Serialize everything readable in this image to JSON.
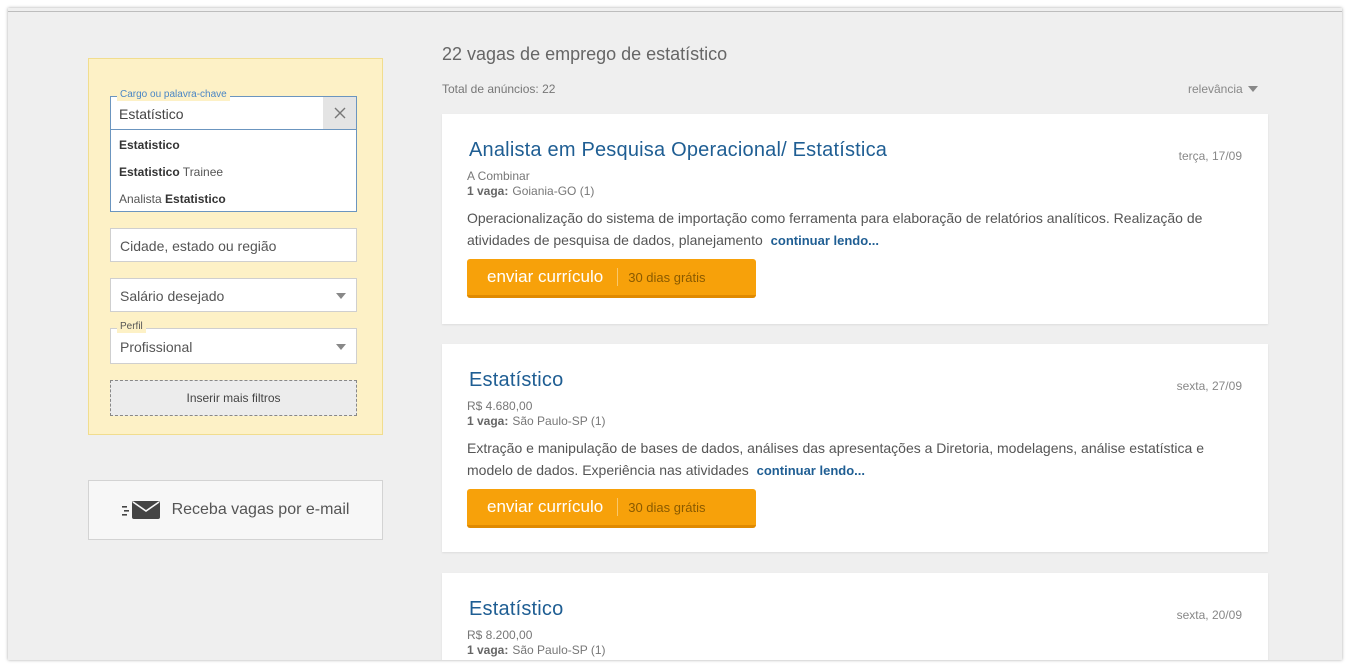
{
  "sidebar": {
    "keyword": {
      "legend": "Cargo ou palavra-chave",
      "value": "Estatístico",
      "suggestions": [
        {
          "bold_prefix": "",
          "bold": "Estatistico",
          "rest": ""
        },
        {
          "bold_prefix": "",
          "bold": "Estatistico",
          "rest": " Trainee"
        },
        {
          "bold_prefix": "Analista ",
          "bold": "Estatistico",
          "rest": ""
        }
      ]
    },
    "city_placeholder": "Cidade, estado ou região",
    "salary_placeholder": "Salário desejado",
    "perfil_legend": "Perfil",
    "perfil_value": "Profissional",
    "more_filters": "Inserir mais filtros",
    "email_alert": "Receba vagas por e-mail"
  },
  "results": {
    "title": "22 vagas de emprego de estatístico",
    "total": "Total de anúncios: 22",
    "sort_label": "relevância"
  },
  "jobs": [
    {
      "title": "Analista em Pesquisa Operacional/ Estatística",
      "date": "terça, 17/09",
      "salary": "A Combinar",
      "vacancies": "1 vaga:",
      "location": "Goiania-GO (1)",
      "description": "Operacionalização do sistema de importação como ferramenta para elaboração de relatórios analíticos. Realização de atividades de pesquisa de dados, planejamento",
      "read_more": "continuar lendo...",
      "apply": "enviar currículo",
      "apply_sub": "30 dias grátis"
    },
    {
      "title": "Estatístico",
      "date": "sexta, 27/09",
      "salary": "R$ 4.680,00",
      "vacancies": "1 vaga:",
      "location": "São Paulo-SP (1)",
      "description": "Extração e manipulação de bases de dados, análises das apresentações a Diretoria, modelagens, análise estatística e modelo de dados. Experiência nas atividades",
      "read_more": "continuar lendo...",
      "apply": "enviar currículo",
      "apply_sub": "30 dias grátis"
    },
    {
      "title": "Estatístico",
      "date": "sexta, 20/09",
      "salary": "R$ 8.200,00",
      "vacancies": "1 vaga:",
      "location": "São Paulo-SP (1)"
    }
  ],
  "colors": {
    "accent_orange": "#f7a10a",
    "link_blue": "#1f5e93",
    "filter_bg": "#fdf1c6"
  }
}
